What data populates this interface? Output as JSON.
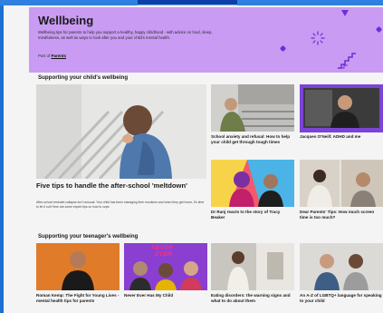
{
  "hero": {
    "title": "Wellbeing",
    "description": "Wellbeing tips for parents to help you support a healthy, happy childhood - with advice on food, sleep, mindfulness, as well as ways to look after you and your child's mental health.",
    "part_of_label": "Part of",
    "part_of_link": "Parents"
  },
  "sections": {
    "child": "Supporting your child's wellbeing",
    "teen": "Supporting your teenager's wellbeing"
  },
  "featured": {
    "title": "Five tips to handle the after-school 'meltdown'",
    "summary": "After-school restraint collapse isn't unusual. Your child has been managing their emotions and when they get home, it's time to let it out! Here are some expert tips on how to cope."
  },
  "child_cards": [
    {
      "title": "School anxiety and refusal: How to help your child get through tough times"
    },
    {
      "title": "Jacques O'Neill: ADHD and me"
    },
    {
      "title": "Dr Ranj reacts to the story of Tracy Beaker"
    },
    {
      "title": "Dear Parents' Tips: How much screen time is too much?"
    }
  ],
  "teen_cards": [
    {
      "title": "Roman Kemp: The Fight for Young Lives - mental health tips for parents"
    },
    {
      "title": "Never Ever Has My Child"
    },
    {
      "title": "Eating disorders: the warning signs and what to do about them"
    },
    {
      "title": "An A-Z of LGBTQ+ language for speaking to your child"
    }
  ],
  "teen_banner": {
    "line1": "NEVER",
    "line2": "EVER"
  },
  "colors": {
    "hero_bg": "#c99bf3",
    "accent": "#6f2bd8",
    "page_bg": "#f4f4f4",
    "outer_bg": "#1d6fd1"
  }
}
